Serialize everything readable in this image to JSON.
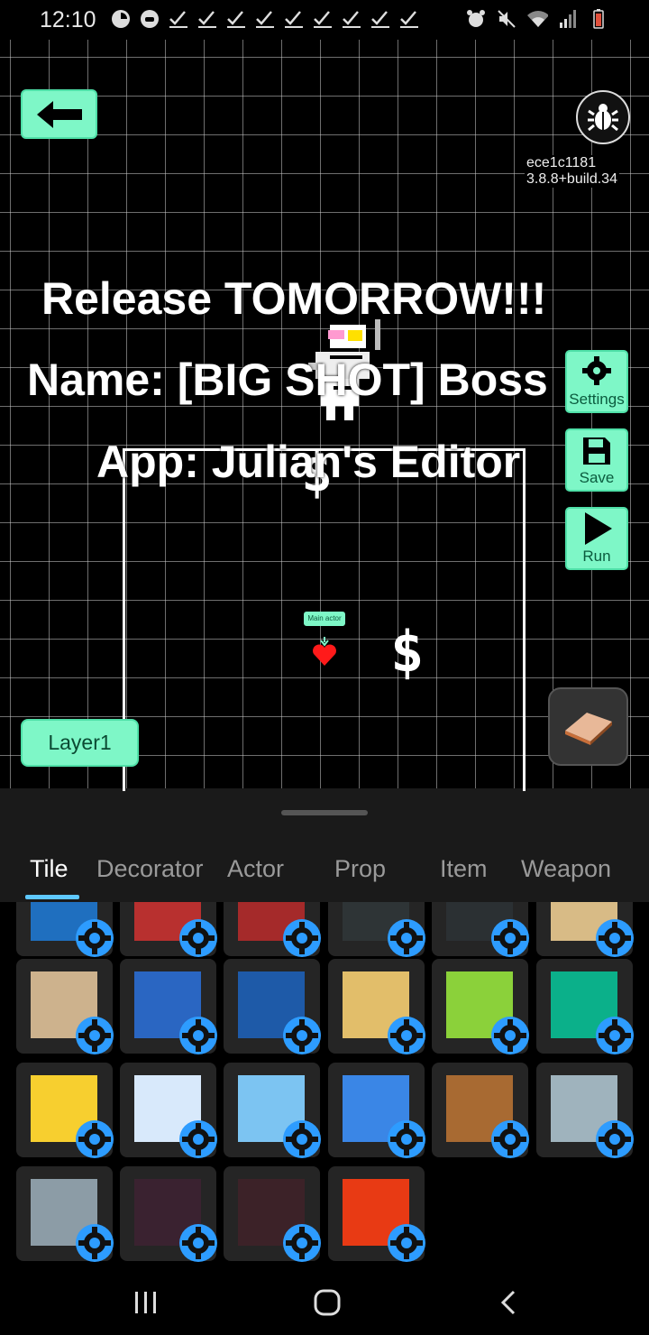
{
  "status_bar": {
    "time": "12:10",
    "left_icons": [
      "whatsapp-icon",
      "game-icon",
      "check-icon",
      "check-icon",
      "check-icon",
      "check-icon",
      "check-icon",
      "check-icon",
      "check-icon",
      "check-icon",
      "check-icon"
    ],
    "right_icons": [
      "alarm-icon",
      "mute-icon",
      "wifi-icon",
      "signal-icon",
      "battery-icon"
    ]
  },
  "editor": {
    "version_commit": "ece1c1181",
    "version_build": "3.8.8+build.34",
    "settings_label": "Settings",
    "save_label": "Save",
    "run_label": "Run",
    "main_actor_label": "Main actor",
    "layer_label": "Layer1"
  },
  "overlay": {
    "line1": "Release TOMORROW!!!",
    "line2": "Name: [BIG SHOT] Boss",
    "line3": "App: Julian's Editor"
  },
  "panel": {
    "tabs": [
      "Tile",
      "Decorator",
      "Actor",
      "Prop",
      "Item",
      "Weapon"
    ],
    "active_tab": "Tile",
    "tiles": [
      {
        "name": "blue-tile",
        "color": "#1f6fbf"
      },
      {
        "name": "red-tile",
        "color": "#b8302f"
      },
      {
        "name": "dark-red-tile",
        "color": "#a52a2a"
      },
      {
        "name": "dark-gray-tile",
        "color": "#2e3436"
      },
      {
        "name": "dark-slate-tile",
        "color": "#2b3033"
      },
      {
        "name": "tan-tile",
        "color": "#d8bb86"
      },
      {
        "name": "sand-tile",
        "color": "#cdb28d"
      },
      {
        "name": "ice-water-tile",
        "color": "#2a66c2"
      },
      {
        "name": "navy-tile",
        "color": "#1e5aa8"
      },
      {
        "name": "light-sand-tile",
        "color": "#e2be6a"
      },
      {
        "name": "lime-tile",
        "color": "#8bd13a"
      },
      {
        "name": "teal-tile",
        "color": "#0bb08a"
      },
      {
        "name": "yellow-tile",
        "color": "#f7cf2f"
      },
      {
        "name": "pale-blue-tile",
        "color": "#d8e9fb"
      },
      {
        "name": "glass-tile",
        "color": "#7cc4f2"
      },
      {
        "name": "bright-blue-tile",
        "color": "#3a86e6"
      },
      {
        "name": "wood-tile",
        "color": "#a86a32"
      },
      {
        "name": "gray-stone-tile",
        "color": "#9fb3bd"
      },
      {
        "name": "cobblestone-tile",
        "color": "#8c9ca6"
      },
      {
        "name": "dark-brick-tile",
        "color": "#3a2230"
      },
      {
        "name": "cracked-rock-tile",
        "color": "#3c2228"
      },
      {
        "name": "lava-tile",
        "color": "#e83a14"
      }
    ]
  },
  "colors": {
    "accent": "#7ef7c7",
    "config_icon": "#2d9cff",
    "tab_indicator": "#5ec8ff"
  }
}
